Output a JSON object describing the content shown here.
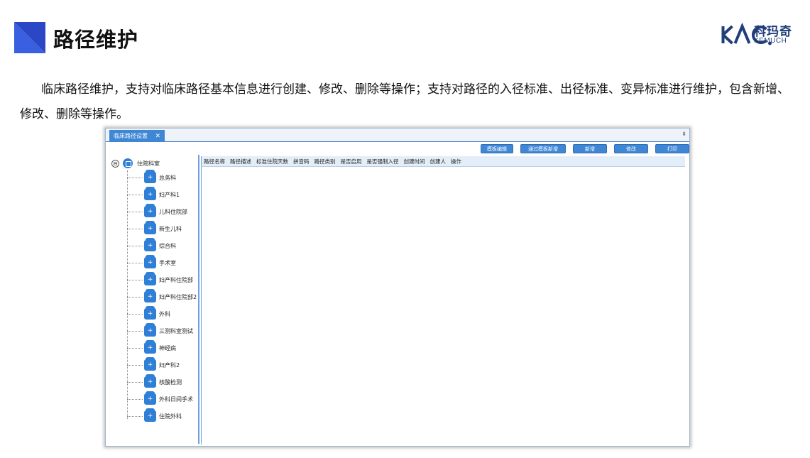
{
  "slide": {
    "title": "路径维护",
    "logo_cn": "科玛奇",
    "logo_en": "KEMUCH",
    "paragraph": "临床路径维护，支持对临床路径基本信息进行创建、修改、删除等操作；支持对路径的入径标准、出径标准、变异标准进行维护，包含新增、修改、删除等操作。",
    "accent_color": "#3a5fe0"
  },
  "app": {
    "tab_label": "临床路径设置",
    "tab_close": "✕",
    "tab_menu": "⇟",
    "toolbar": {
      "template_edit": "模板编辑",
      "add_via_template": "通过模板新增",
      "add": "新增",
      "modify": "修改",
      "print": "打印"
    },
    "tree": {
      "root_label": "住院科室",
      "collapse_symbol": "⊖",
      "items": [
        {
          "label": "总务科"
        },
        {
          "label": "妇产科1"
        },
        {
          "label": "儿科住院部"
        },
        {
          "label": "新生儿科"
        },
        {
          "label": "综合科"
        },
        {
          "label": "手术室"
        },
        {
          "label": "妇产科住院部"
        },
        {
          "label": "妇产科住院部2"
        },
        {
          "label": "外科"
        },
        {
          "label": "三测科室测试"
        },
        {
          "label": "神经病"
        },
        {
          "label": "妇产科2"
        },
        {
          "label": "核酸检测"
        },
        {
          "label": "外科日间手术"
        },
        {
          "label": "住院外科"
        }
      ]
    },
    "grid_columns": [
      "路径名称",
      "路径描述",
      "标准住院天数",
      "拼音码",
      "路径类别",
      "是否启用",
      "是否强制入径",
      "创建时间",
      "创建人",
      "操作"
    ]
  }
}
